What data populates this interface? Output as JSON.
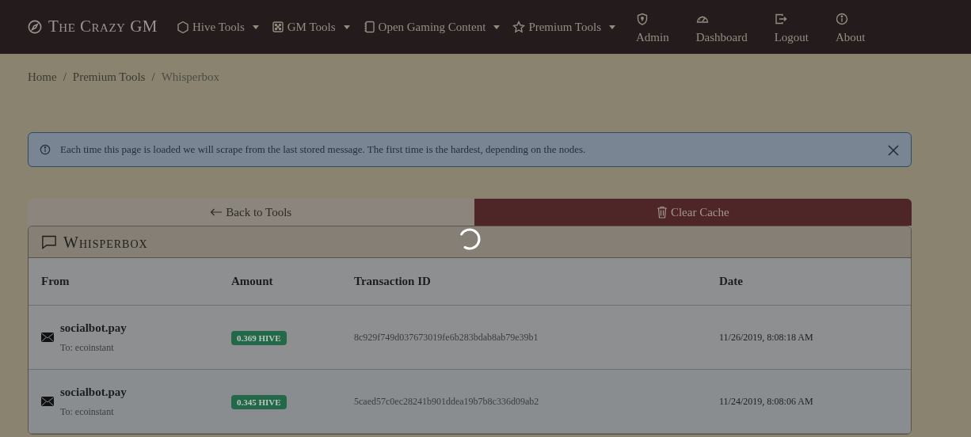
{
  "brand": "The Crazy GM",
  "nav": [
    {
      "label": "Hive Tools",
      "kind": "dropdown"
    },
    {
      "label": "GM Tools",
      "kind": "dropdown"
    },
    {
      "label": "Open Gaming Content",
      "kind": "dropdown"
    },
    {
      "label": "Premium Tools",
      "kind": "dropdown"
    },
    {
      "label": "Admin",
      "kind": "stacked"
    },
    {
      "label": "Dashboard",
      "kind": "stacked"
    },
    {
      "label": "Logout",
      "kind": "stacked"
    },
    {
      "label": "About",
      "kind": "stacked"
    }
  ],
  "breadcrumb": [
    {
      "label": "Home",
      "current": false
    },
    {
      "separator": "/",
      "label": "Premium Tools",
      "current": false
    },
    {
      "separator": "/",
      "label": "Whisperbox",
      "current": true
    }
  ],
  "alert": {
    "text": "Each time this page is loaded we will scrape from the last stored message. The first time is the hardest, depending on the nodes."
  },
  "actions": [
    {
      "label": "Back to Tools",
      "kind": "back"
    },
    {
      "label": "Clear Cache",
      "kind": "danger"
    }
  ],
  "card": {
    "title": "Whisperbox",
    "loading": true,
    "columns": [
      "From",
      "Amount",
      "Transaction ID",
      "Date"
    ],
    "rows": [
      {
        "from": "socialbot.pay",
        "to": "To: ecoinstant",
        "amount": "0.369 HIVE",
        "txid": "8c929f749d037673019fe6b283bdab8ab79e39b1",
        "date": "11/26/2019, 8:08:18 AM"
      },
      {
        "from": "socialbot.pay",
        "to": "To: ecoinstant",
        "amount": "0.345 HIVE",
        "txid": "5caed57c0ec28241b901ddea19b7b8c336d09ab2",
        "date": "11/24/2019, 8:08:06 AM"
      }
    ]
  }
}
